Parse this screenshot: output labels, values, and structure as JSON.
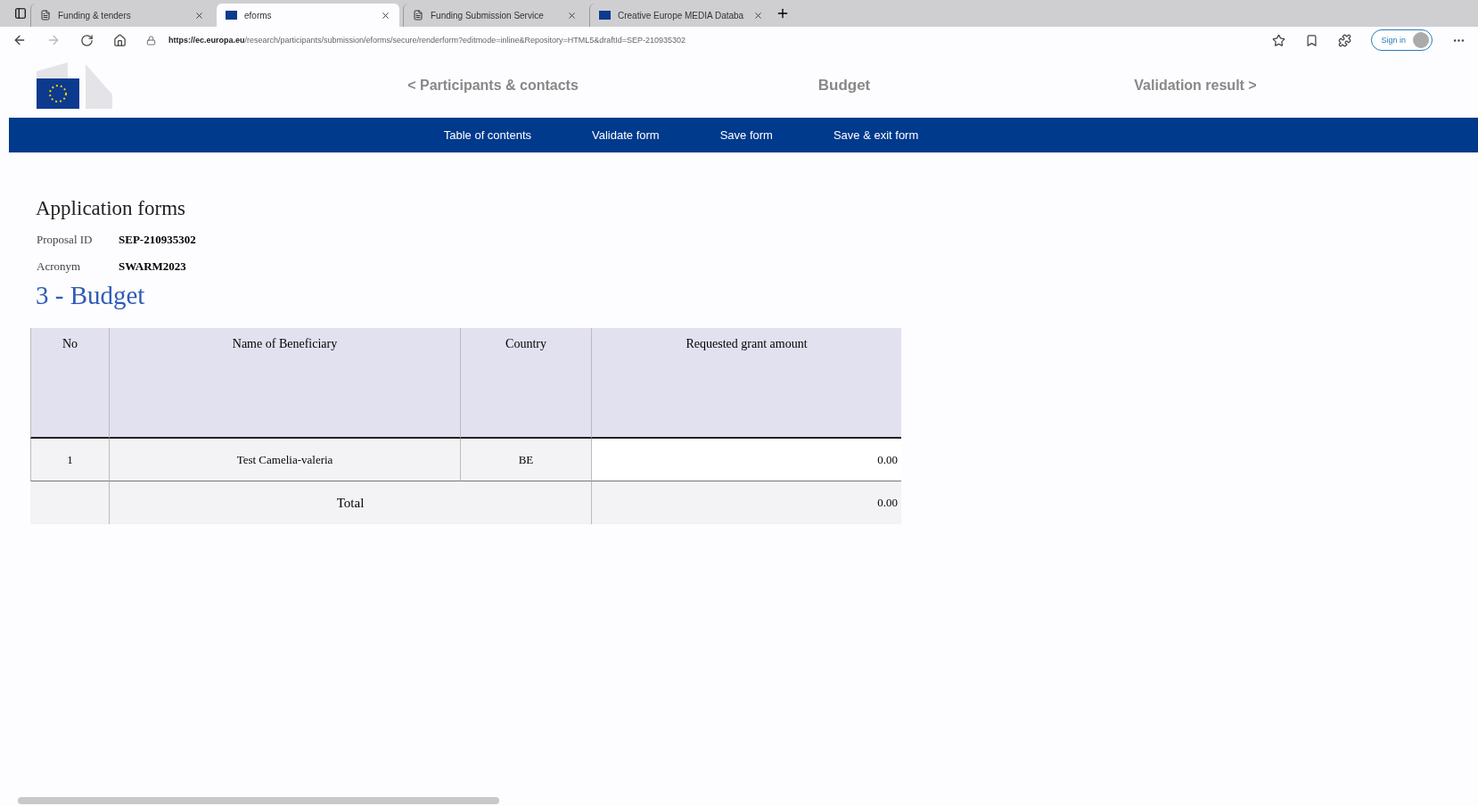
{
  "browser": {
    "tabs": [
      {
        "title": "Funding & tenders",
        "kind": "page",
        "selected": false
      },
      {
        "title": "eforms",
        "kind": "flag",
        "selected": true
      },
      {
        "title": "Funding Submission Service",
        "kind": "page",
        "selected": false
      },
      {
        "title": "Creative Europe MEDIA Databa",
        "kind": "flag",
        "selected": false
      }
    ],
    "url_host": "https://ec.europa.eu",
    "url_path": "/research/participants/submission/eforms/secure/renderform?editmode=inline&Repository=HTML5&draftId=SEP-210935302",
    "sign_in": "Sign in"
  },
  "form_nav": {
    "previous": "< Participants & contacts",
    "current": "Budget",
    "next": "Validation result >"
  },
  "toolbar": [
    "Table of contents",
    "Validate form",
    "Save form",
    "Save & exit form"
  ],
  "page_title": "Application forms",
  "meta": [
    {
      "label": "Proposal ID",
      "value": "SEP-210935302"
    },
    {
      "label": "Acronym",
      "value": "SWARM2023"
    }
  ],
  "section_title": "3 - Budget",
  "table": {
    "columns": [
      "No",
      "Name of Beneficiary",
      "Country",
      "Requested grant amount"
    ],
    "rows": [
      {
        "no": "1",
        "name": "Test Camelia-valeria",
        "country": "BE",
        "amount": "0.00"
      }
    ],
    "total": {
      "label": "Total",
      "amount": "0.00"
    }
  }
}
